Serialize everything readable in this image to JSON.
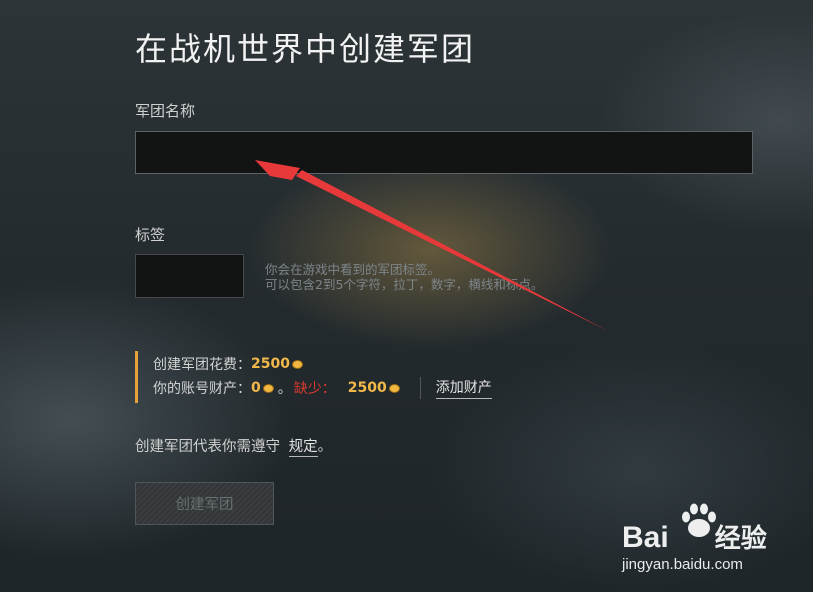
{
  "page": {
    "title": "在战机世界中创建军团"
  },
  "form": {
    "name_label": "军团名称",
    "name_value": "",
    "tag_label": "标签",
    "tag_value": "",
    "tag_hint_line1": "你会在游戏中看到的军团标签。",
    "tag_hint_line2": "可以包含2到5个字符，拉丁，数字，横线和标点。"
  },
  "cost": {
    "cost_label": "创建军团花费：",
    "cost_value": "2500",
    "balance_label": "你的账号财产：",
    "balance_value": "0",
    "balance_suffix": "。",
    "missing_label": "缺少：",
    "missing_value": "2500",
    "add_funds_label": "添加财产",
    "currency_icon": "gold-coin-icon"
  },
  "rules": {
    "text": "创建军团代表你需遵守",
    "link_label": "规定",
    "suffix": "。"
  },
  "actions": {
    "create_label": "创建军团"
  },
  "watermark": {
    "logo_text": "Bai",
    "logo_suffix": "经验",
    "url": "jingyan.baidu.com"
  },
  "colors": {
    "accent_gold": "#f3b84a",
    "warning_red": "#d93a2f",
    "annotation_arrow": "#e8393a"
  }
}
